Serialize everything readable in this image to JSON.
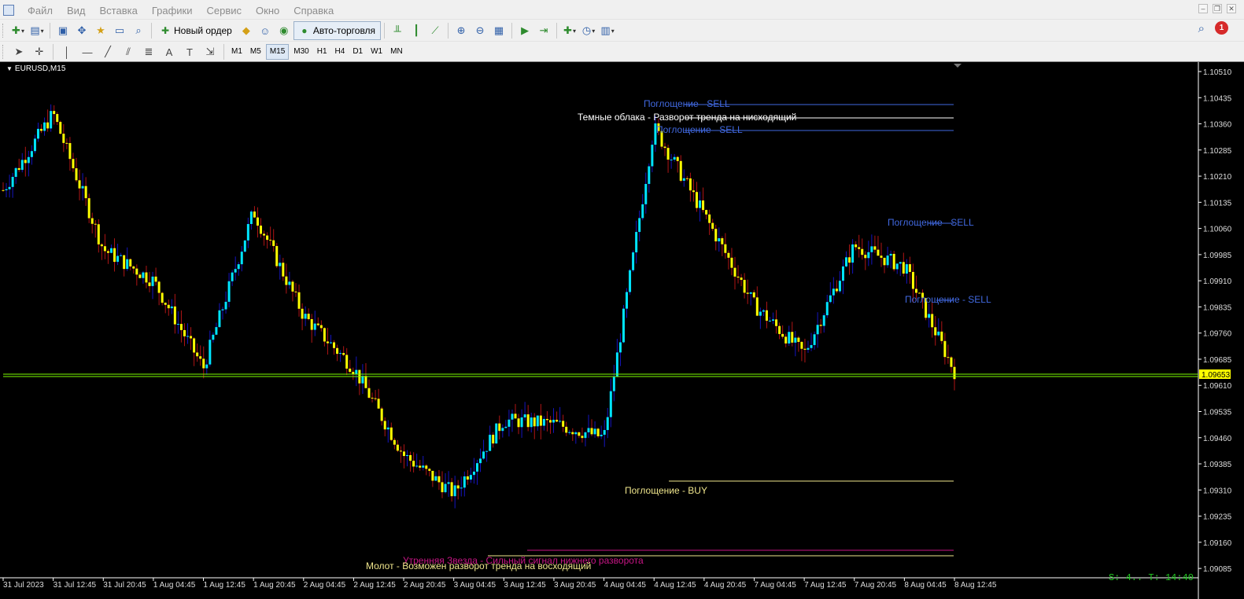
{
  "menu": [
    "Файл",
    "Вид",
    "Вставка",
    "Графики",
    "Сервис",
    "Окно",
    "Справка"
  ],
  "toolbar": {
    "new_order": "Новый ордер",
    "auto_trading": "Авто-торговля",
    "notifications": "1"
  },
  "timeframes": [
    "M1",
    "M5",
    "M15",
    "M30",
    "H1",
    "H4",
    "D1",
    "W1",
    "MN"
  ],
  "active_timeframe": "M15",
  "chart": {
    "symbol_label": "EURUSD,M15",
    "current_price": "1.09653",
    "status_text": "S: 4.. T: 14:40",
    "price_ticks": [
      "1.10510",
      "1.10435",
      "1.10360",
      "1.10285",
      "1.10210",
      "1.10135",
      "1.10060",
      "1.09985",
      "1.09910",
      "1.09835",
      "1.09760",
      "1.09685",
      "1.09610",
      "1.09535",
      "1.09460",
      "1.09385",
      "1.09310",
      "1.09235",
      "1.09160",
      "1.09085"
    ],
    "time_ticks": [
      "31 Jul 2023",
      "31 Jul 12:45",
      "31 Jul 20:45",
      "1 Aug 04:45",
      "1 Aug 12:45",
      "1 Aug 20:45",
      "2 Aug 04:45",
      "2 Aug 12:45",
      "2 Aug 20:45",
      "3 Aug 04:45",
      "3 Aug 12:45",
      "3 Aug 20:45",
      "4 Aug 04:45",
      "4 Aug 12:45",
      "4 Aug 20:45",
      "7 Aug 04:45",
      "7 Aug 12:45",
      "7 Aug 20:45",
      "8 Aug 04:45",
      "8 Aug 12:45"
    ],
    "annotations": [
      {
        "text": "Поглощение - SELL",
        "color": "#4169e1"
      },
      {
        "text": "Темные облака - Разворот тренда на нисходящий",
        "color": "#ffffff"
      },
      {
        "text": "Поглощение - SELL",
        "color": "#4169e1"
      },
      {
        "text": "Поглощение - SELL",
        "color": "#4169e1"
      },
      {
        "text": "Поглощение - SELL",
        "color": "#4169e1"
      },
      {
        "text": "Поглощение - BUY",
        "color": "#f0e68c"
      },
      {
        "text": "Утренняя Звезда - Сильный сигнал нижнего разворота",
        "color": "#c71585"
      },
      {
        "text": "Молот - Возможен разворот тренда на восходящий",
        "color": "#f0e68c"
      }
    ],
    "colors": {
      "background": "#000000",
      "bull": "#00e5ff",
      "bear": "#ffff00",
      "wick_bull": "#1515c0",
      "wick_bear": "#b01515",
      "price_line": "#7cfc00",
      "price_badge": "#ffff00"
    }
  },
  "chart_data": {
    "type": "line",
    "symbol": "EURUSD",
    "timeframe": "M15",
    "x": [
      "31 Jul 2023",
      "31 Jul 12:45",
      "31 Jul 20:45",
      "1 Aug 04:45",
      "1 Aug 12:45",
      "1 Aug 20:45",
      "2 Aug 04:45",
      "2 Aug 12:45",
      "2 Aug 20:45",
      "3 Aug 04:45",
      "3 Aug 12:45",
      "3 Aug 20:45",
      "4 Aug 04:45",
      "4 Aug 12:45",
      "4 Aug 20:45",
      "7 Aug 04:45",
      "7 Aug 12:45",
      "7 Aug 20:45",
      "8 Aug 04:45",
      "8 Aug 12:45"
    ],
    "series": [
      {
        "values": [
          1.1017,
          1.1039,
          1.1,
          1.0991,
          1.0966,
          1.1011,
          1.0981,
          1.0966,
          1.0941,
          1.093,
          1.0951,
          1.095,
          1.0946,
          1.1035,
          1.101,
          1.0984,
          1.097,
          1.1001,
          1.0995,
          1.0965
        ]
      }
    ],
    "ylim": [
      1.0908,
      1.1051
    ],
    "current_price": 1.09653
  }
}
